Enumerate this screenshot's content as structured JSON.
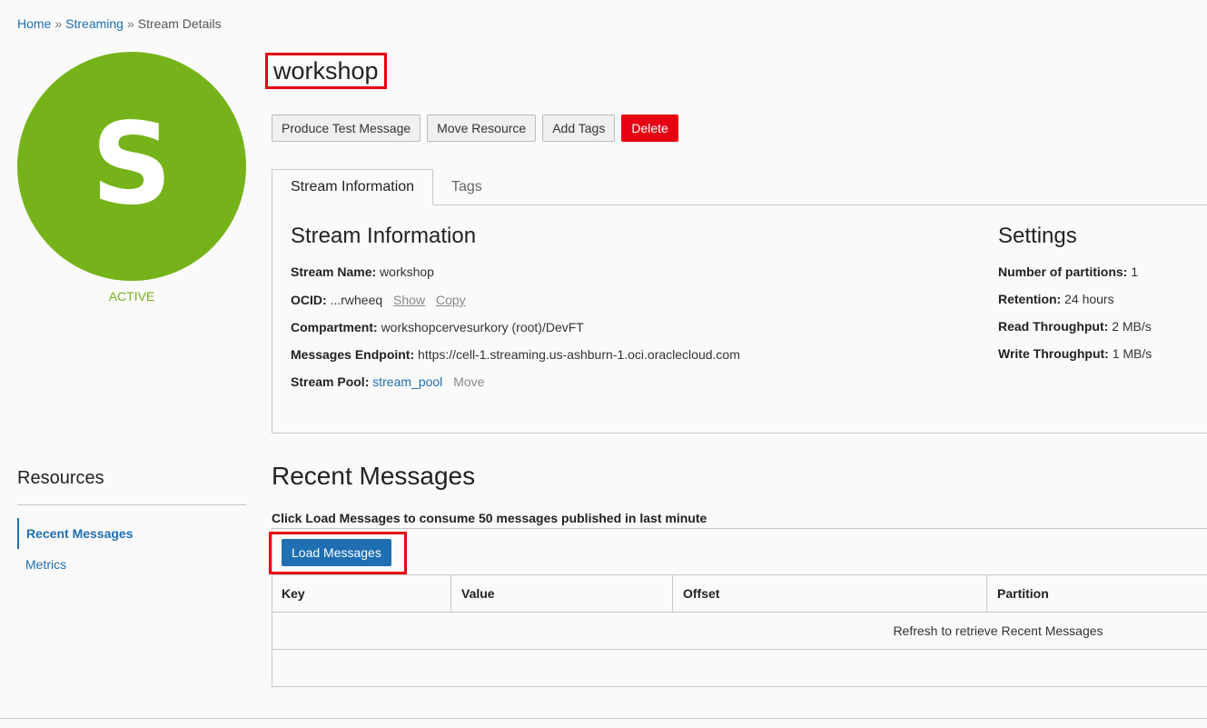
{
  "breadcrumb": {
    "home": "Home",
    "separator": "»",
    "streaming": "Streaming",
    "current": "Stream Details"
  },
  "avatar": {
    "letter": "S",
    "status": "ACTIVE",
    "color": "#76b31a"
  },
  "title": "workshop",
  "actions": {
    "produce": "Produce Test Message",
    "move": "Move Resource",
    "tags": "Add Tags",
    "delete": "Delete"
  },
  "tabs": [
    {
      "label": "Stream Information",
      "active": true
    },
    {
      "label": "Tags",
      "active": false
    }
  ],
  "stream_info": {
    "heading": "Stream Information",
    "name_label": "Stream Name:",
    "name_value": "workshop",
    "ocid_label": "OCID:",
    "ocid_value": "...rwheeq",
    "ocid_show": "Show",
    "ocid_copy": "Copy",
    "compartment_label": "Compartment:",
    "compartment_value": "workshopcervesurkory (root)/DevFT",
    "endpoint_label": "Messages Endpoint:",
    "endpoint_value": "https://cell-1.streaming.us-ashburn-1.oci.oraclecloud.com",
    "pool_label": "Stream Pool:",
    "pool_value": "stream_pool",
    "pool_move": "Move"
  },
  "settings": {
    "heading": "Settings",
    "partitions_label": "Number of partitions:",
    "partitions_value": "1",
    "retention_label": "Retention:",
    "retention_value": "24 hours",
    "read_label": "Read Throughput:",
    "read_value": "2 MB/s",
    "write_label": "Write Throughput:",
    "write_value": "1 MB/s"
  },
  "resources": {
    "title": "Resources",
    "items": [
      "Recent Messages",
      "Metrics"
    ]
  },
  "recent_messages": {
    "title": "Recent Messages",
    "description": "Click Load Messages to consume 50 messages published in last minute",
    "load_button": "Load Messages",
    "columns": [
      "Key",
      "Value",
      "Offset",
      "Partition"
    ],
    "empty_text": "Refresh to retrieve Recent Messages"
  },
  "colors": {
    "accent": "#1f6fb2",
    "danger": "#e60012",
    "active": "#76b31a"
  }
}
